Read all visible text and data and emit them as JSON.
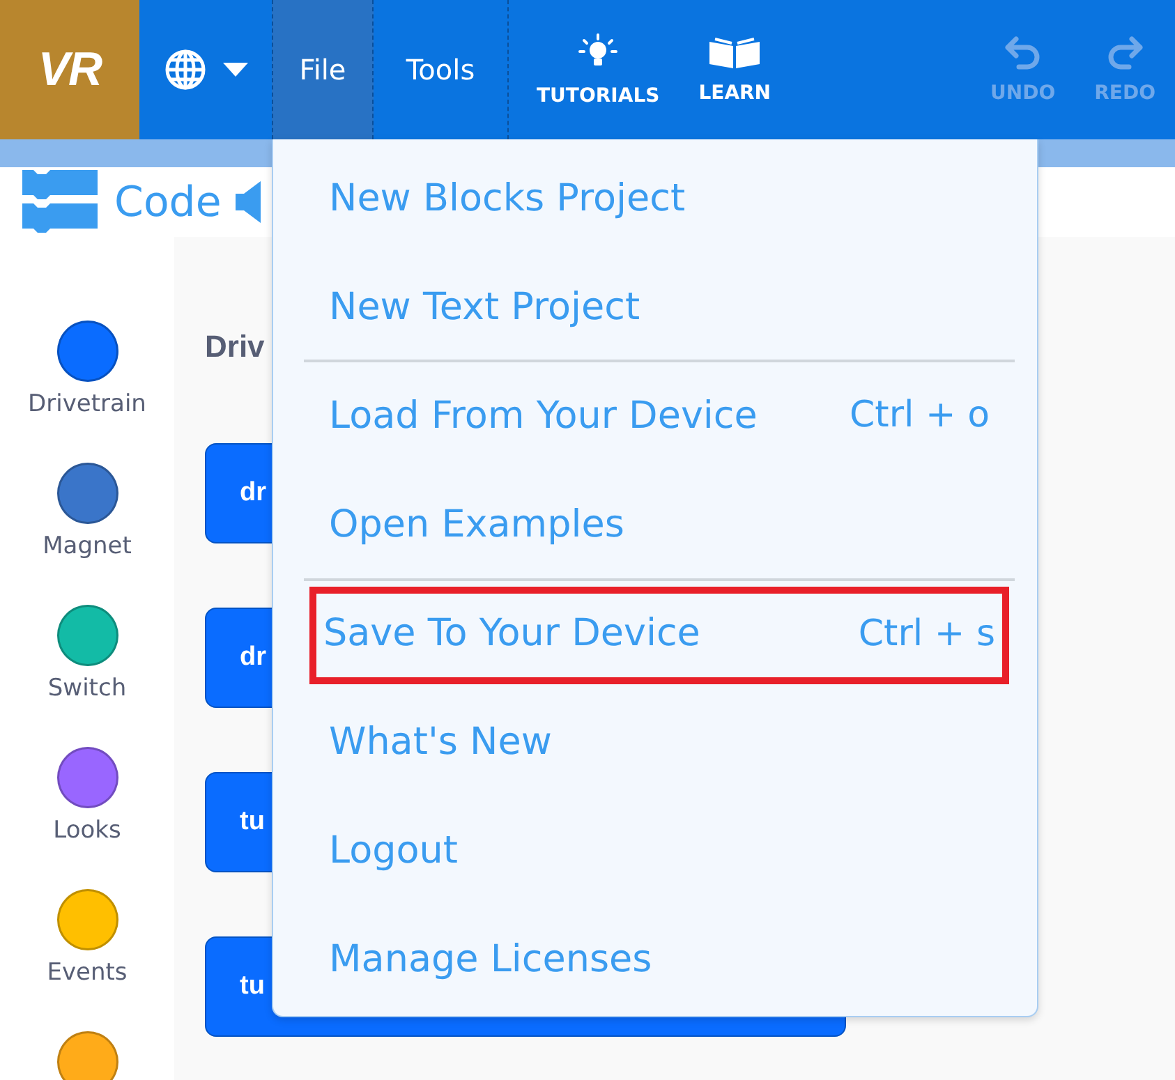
{
  "top_bar": {
    "logo": "VR",
    "nav": [
      {
        "label": "File",
        "selected": true
      },
      {
        "label": "Tools",
        "selected": false
      }
    ],
    "actions": [
      {
        "kind": "tutorials",
        "label": "TUTORIALS",
        "disabled": false
      },
      {
        "kind": "learn",
        "label": "LEARN",
        "disabled": false
      },
      {
        "kind": "undo",
        "label": "UNDO",
        "disabled": true
      },
      {
        "kind": "redo",
        "label": "REDO",
        "disabled": true
      }
    ]
  },
  "panel": {
    "title": "Code",
    "section_title": "Driv",
    "categories": [
      {
        "label": "Drivetrain",
        "color": "#0a6cff"
      },
      {
        "label": "Magnet",
        "color": "#3a75c9"
      },
      {
        "label": "Switch",
        "color": "#13bba6"
      },
      {
        "label": "Looks",
        "color": "#9966ff"
      },
      {
        "label": "Events",
        "color": "#ffbf00"
      },
      {
        "color": "#ffab19"
      }
    ],
    "blocks": [
      {
        "label": "dr",
        "wide": false
      },
      {
        "label": "dr",
        "wide": false
      },
      {
        "label": "tu",
        "wide": false
      },
      {
        "label": "tu",
        "wide": true
      }
    ]
  },
  "file_menu": {
    "items": [
      {
        "label": "New Blocks Project",
        "highlighted": false,
        "divider_after": false
      },
      {
        "label": "New Text Project",
        "highlighted": false,
        "divider_after": true
      },
      {
        "label": "Load From Your Device",
        "shortcut": "Ctrl + o",
        "highlighted": false,
        "divider_after": false
      },
      {
        "label": "Open Examples",
        "highlighted": false,
        "divider_after": true
      },
      {
        "label": "Save To Your Device",
        "shortcut": "Ctrl + s",
        "highlighted": true,
        "divider_after": false
      },
      {
        "label": "What's New",
        "highlighted": false,
        "divider_after": false
      },
      {
        "label": "Logout",
        "highlighted": false,
        "divider_after": false
      },
      {
        "label": "Manage Licenses",
        "highlighted": false,
        "divider_after": false
      }
    ]
  }
}
